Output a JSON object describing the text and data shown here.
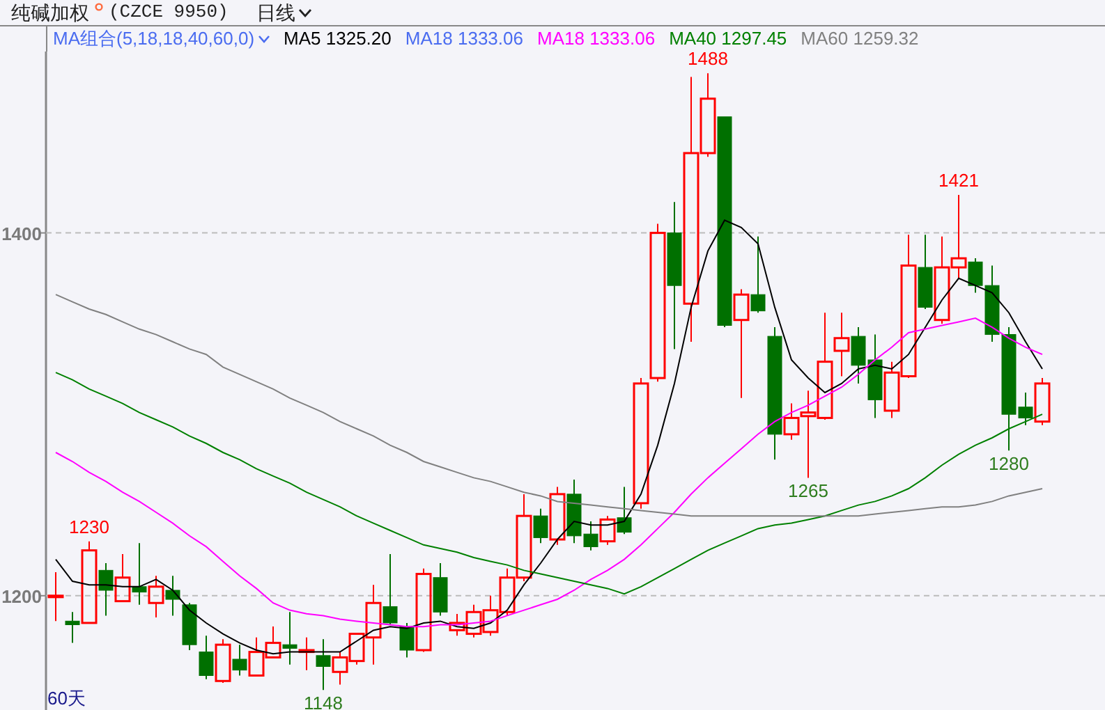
{
  "header": {
    "title": "纯碱加权",
    "code": "(CZCE 9950)",
    "period": "日线"
  },
  "legend": {
    "group": "MA组合(5,18,18,40,60,0)",
    "items": [
      {
        "kind": "series",
        "value": "1325.20"
      },
      {
        "kind": "plain",
        "label": "MA18",
        "value": "1333.06",
        "color": "#4a6cf0"
      },
      {
        "kind": "series",
        "value": "1333.06"
      },
      {
        "kind": "series",
        "value": "1297.45"
      },
      {
        "kind": "series",
        "value": "1259.32"
      }
    ]
  },
  "chart": {
    "period_label": "60天",
    "chart_data": {
      "type": "candlestick",
      "ylim": [
        1137,
        1500
      ],
      "yticks": [
        1200,
        1400
      ],
      "ohlc": [
        [
          1200,
          1213,
          1186,
          1200
        ],
        [
          1186,
          1191,
          1174,
          1184
        ],
        [
          1185,
          1230,
          1185,
          1225
        ],
        [
          1214,
          1218,
          1189,
          1203
        ],
        [
          1197,
          1223,
          1197,
          1210
        ],
        [
          1205,
          1229,
          1195,
          1202
        ],
        [
          1196,
          1211,
          1188,
          1205
        ],
        [
          1203,
          1211,
          1189,
          1198
        ],
        [
          1195,
          1196,
          1170,
          1173
        ],
        [
          1169,
          1178,
          1154,
          1156
        ],
        [
          1153,
          1176,
          1152,
          1173
        ],
        [
          1165,
          1173,
          1156,
          1159
        ],
        [
          1156,
          1177,
          1156,
          1169
        ],
        [
          1166,
          1183,
          1166,
          1174
        ],
        [
          1173,
          1191,
          1162,
          1171
        ],
        [
          1169,
          1177,
          1159,
          1170
        ],
        [
          1167,
          1176,
          1148,
          1161
        ],
        [
          1158,
          1169,
          1151,
          1166
        ],
        [
          1164,
          1179,
          1162,
          1179
        ],
        [
          1177,
          1206,
          1162,
          1196
        ],
        [
          1194,
          1223,
          1184,
          1185
        ],
        [
          1183,
          1185,
          1166,
          1170
        ],
        [
          1170,
          1215,
          1169,
          1212
        ],
        [
          1210,
          1218,
          1189,
          1191
        ],
        [
          1181,
          1190,
          1178,
          1185
        ],
        [
          1179,
          1195,
          1177,
          1191
        ],
        [
          1180,
          1200,
          1178,
          1192
        ],
        [
          1191,
          1215,
          1189,
          1210
        ],
        [
          1210,
          1256,
          1208,
          1244
        ],
        [
          1244,
          1248,
          1229,
          1232
        ],
        [
          1231,
          1260,
          1228,
          1256
        ],
        [
          1256,
          1264,
          1229,
          1233
        ],
        [
          1234,
          1241,
          1225,
          1227
        ],
        [
          1230,
          1244,
          1228,
          1242
        ],
        [
          1243,
          1260,
          1234,
          1235
        ],
        [
          1251,
          1320,
          1248,
          1317
        ],
        [
          1320,
          1405,
          1318,
          1400
        ],
        [
          1400,
          1417,
          1336,
          1371
        ],
        [
          1361,
          1486,
          1340,
          1444
        ],
        [
          1444,
          1488,
          1442,
          1474
        ],
        [
          1464,
          1464,
          1348,
          1349
        ],
        [
          1352,
          1369,
          1309,
          1366
        ],
        [
          1366,
          1398,
          1356,
          1357
        ],
        [
          1343,
          1348,
          1275,
          1289
        ],
        [
          1289,
          1306,
          1286,
          1298
        ],
        [
          1299,
          1313,
          1265,
          1301
        ],
        [
          1298,
          1356,
          1297,
          1329
        ],
        [
          1335,
          1356,
          1321,
          1342
        ],
        [
          1343,
          1348,
          1317,
          1327
        ],
        [
          1330,
          1344,
          1298,
          1308
        ],
        [
          1302,
          1329,
          1298,
          1323
        ],
        [
          1321,
          1399,
          1320,
          1382
        ],
        [
          1381,
          1399,
          1358,
          1359
        ],
        [
          1352,
          1398,
          1350,
          1381
        ],
        [
          1381,
          1421,
          1375,
          1386
        ],
        [
          1384,
          1386,
          1367,
          1371
        ],
        [
          1371,
          1382,
          1340,
          1344
        ],
        [
          1344,
          1348,
          1280,
          1300
        ],
        [
          1304,
          1312,
          1294,
          1298
        ],
        [
          1296,
          1320,
          1294,
          1317
        ]
      ],
      "annotations": [
        {
          "y": 1230,
          "text": "1230"
        },
        {
          "y": 1148,
          "text": "1148"
        },
        {
          "y": 1488,
          "text": "1488"
        },
        {
          "y": 1265,
          "text": "1265"
        },
        {
          "y": 1421,
          "text": "1421"
        },
        {
          "y": 1280,
          "text": "1280"
        }
      ]
    },
    "moving_averages": {
      "chart_data": {
        "type": "line",
        "ylim": [
          1137,
          1500
        ],
        "series": [
          {
            "name": "MA5",
            "color": "#000000",
            "values": [
              1220,
              1208,
              1206,
              1206,
              1205,
              1205,
              1209,
              1203,
              1192,
              1185,
              1179,
              1174,
              1170,
              1168,
              1169,
              1169,
              1169,
              1169,
              1175,
              1181,
              1183,
              1182,
              1185,
              1186,
              1183,
              1182,
              1185,
              1192,
              1206,
              1218,
              1231,
              1241,
              1239,
              1239,
              1241,
              1256,
              1283,
              1317,
              1359,
              1390,
              1407,
              1403,
              1394,
              1359,
              1330,
              1320,
              1312,
              1317,
              1325,
              1327,
              1325,
              1333,
              1348,
              1363,
              1375,
              1371,
              1367,
              1356,
              1340,
              1325
            ]
          },
          {
            "name": "MA18",
            "color": "#ff00ff",
            "values": [
              1279,
              1274,
              1268,
              1263,
              1257,
              1252,
              1246,
              1240,
              1233,
              1227,
              1219,
              1211,
              1204,
              1196,
              1192,
              1190,
              1189,
              1187,
              1186,
              1185,
              1184,
              1183,
              1183,
              1184,
              1184,
              1185,
              1186,
              1189,
              1192,
              1195,
              1198,
              1203,
              1209,
              1214,
              1220,
              1228,
              1237,
              1246,
              1256,
              1265,
              1273,
              1281,
              1289,
              1296,
              1301,
              1305,
              1310,
              1315,
              1322,
              1330,
              1337,
              1345,
              1347,
              1349,
              1351,
              1353,
              1348,
              1342,
              1337,
              1333
            ]
          },
          {
            "name": "MA40",
            "color": "#008000",
            "values": [
              1323,
              1319,
              1314,
              1310,
              1306,
              1301,
              1297,
              1293,
              1288,
              1284,
              1279,
              1275,
              1270,
              1266,
              1262,
              1257,
              1253,
              1249,
              1244,
              1240,
              1236,
              1232,
              1228,
              1226,
              1224,
              1221,
              1219,
              1217,
              1214,
              1212,
              1210,
              1208,
              1206,
              1204,
              1201,
              1205,
              1210,
              1215,
              1220,
              1225,
              1229,
              1233,
              1237,
              1239,
              1240,
              1242,
              1244,
              1247,
              1250,
              1252,
              1255,
              1259,
              1265,
              1272,
              1278,
              1283,
              1287,
              1292,
              1296,
              1300
            ]
          },
          {
            "name": "MA60",
            "color": "#808080",
            "values": [
              1366,
              1362,
              1358,
              1355,
              1351,
              1347,
              1344,
              1340,
              1336,
              1333,
              1326,
              1322,
              1318,
              1314,
              1309,
              1305,
              1301,
              1296,
              1292,
              1288,
              1283,
              1279,
              1274,
              1271,
              1268,
              1265,
              1263,
              1260,
              1257,
              1255,
              1252,
              1251,
              1250,
              1249,
              1248,
              1247,
              1246,
              1245,
              1244,
              1244,
              1244,
              1244,
              1244,
              1244,
              1244,
              1244,
              1244,
              1244,
              1244,
              1245,
              1246,
              1247,
              1248,
              1249,
              1249,
              1250,
              1252,
              1255,
              1257,
              1259
            ]
          }
        ]
      }
    }
  }
}
